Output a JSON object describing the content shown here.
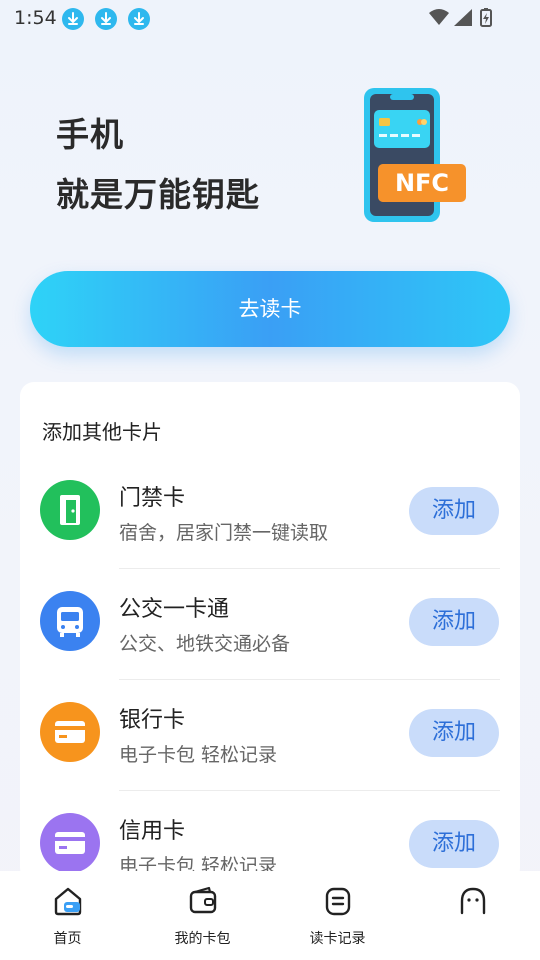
{
  "status_bar": {
    "time": "1:54",
    "notification_icons": [
      "download-icon",
      "download-icon",
      "download-icon"
    ],
    "system_icons": [
      "wifi-icon",
      "signal-icon",
      "battery-charging-icon"
    ]
  },
  "hero": {
    "line1": "手机",
    "line2": "就是万能钥匙",
    "nfc_label": "NFC"
  },
  "read_button": {
    "label": "去读卡"
  },
  "add_cards": {
    "title": "添加其他卡片",
    "items": [
      {
        "name": "门禁卡",
        "desc": "宿舍，居家门禁一键读取",
        "button": "添加",
        "icon": "door-icon",
        "color": "#22c05c"
      },
      {
        "name": "公交一卡通",
        "desc": "公交、地铁交通必备",
        "button": "添加",
        "icon": "bus-icon",
        "color": "#3b82f0"
      },
      {
        "name": "银行卡",
        "desc": "电子卡包  轻松记录",
        "button": "添加",
        "icon": "bank-card-icon",
        "color": "#f7941d"
      },
      {
        "name": "信用卡",
        "desc": "电子卡包  轻松记录",
        "button": "添加",
        "icon": "credit-card-icon",
        "color": "#9b74f0"
      }
    ]
  },
  "tab_bar": {
    "tabs": [
      {
        "label": "首页",
        "icon": "home-icon",
        "active": true
      },
      {
        "label": "我的卡包",
        "icon": "wallet-icon",
        "active": false
      },
      {
        "label": "读卡记录",
        "icon": "record-icon",
        "active": false
      },
      {
        "label": "",
        "icon": "chat-icon",
        "active": false
      }
    ]
  },
  "colors": {
    "accent": "#3a9ff5",
    "add_button_bg": "#c9dcfa",
    "add_button_text": "#2d6fd8"
  }
}
